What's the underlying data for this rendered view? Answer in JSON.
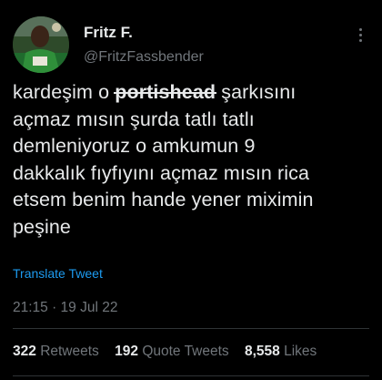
{
  "tweet": {
    "display_name": "Fritz F.",
    "handle": "@FritzFassbender",
    "body_lines": [
      {
        "pre": "kardeşim o ",
        "strike": "portishead",
        "post": " şarkısını"
      },
      {
        "text": "açmaz mısın şurda tatlı tatlı"
      },
      {
        "text": "demleniyoruz o amkumun 9"
      },
      {
        "text": "dakkalık fıyfıyını açmaz mısın rica"
      },
      {
        "text": "etsem benim hande yener miximin"
      },
      {
        "text": "peşine"
      }
    ],
    "translate_label": "Translate Tweet",
    "timestamp": "21:15 · 19 Jul 22",
    "stats": {
      "retweets": {
        "count": "322",
        "label": "Retweets"
      },
      "quotes": {
        "count": "192",
        "label": "Quote Tweets"
      },
      "likes": {
        "count": "8,558",
        "label": "Likes"
      }
    },
    "icons": {
      "more": "more-options-icon"
    },
    "colors": {
      "background": "#000000",
      "text": "#e7e9ea",
      "muted": "#71767b",
      "link": "#1d9bf0"
    }
  }
}
